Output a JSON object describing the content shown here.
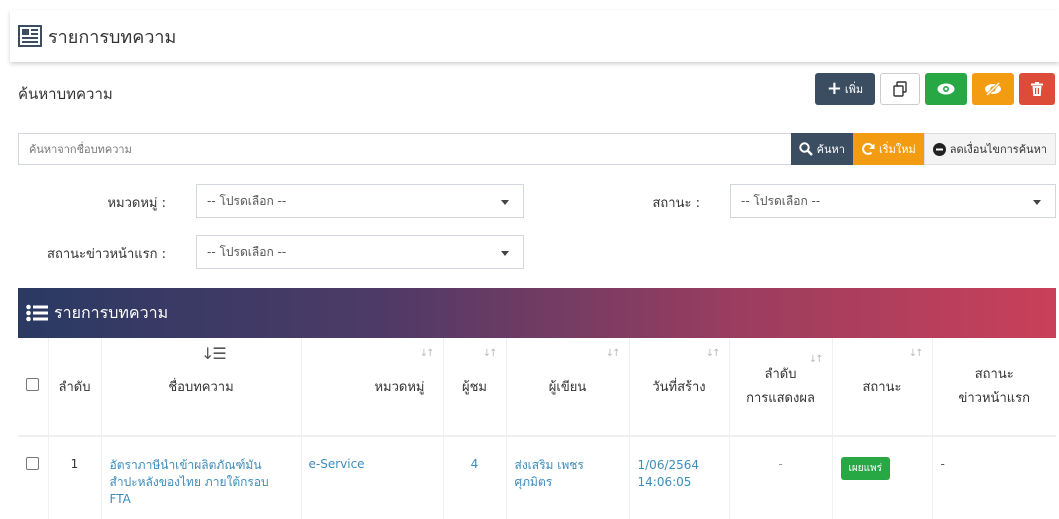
{
  "header": {
    "title": "รายการบทความ"
  },
  "search": {
    "title": "ค้นหาบทความ",
    "placeholder": "ค้นหาจากชื่อบทความ",
    "find_label": "ค้นหา",
    "reset_label": "เริ่มใหม่",
    "less_label": "ลดเงื่อนไขการค้นหา"
  },
  "toolbar": {
    "add_label": "เพิ่ม"
  },
  "filters": {
    "category_label": "หมวดหมู่ :",
    "category_value": "-- โปรดเลือก --",
    "status_label": "สถานะ :",
    "status_value": "-- โปรดเลือก --",
    "headline_label": "สถานะข่าวหน้าแรก :",
    "headline_value": "-- โปรดเลือก --"
  },
  "list": {
    "title": "รายการบทความ",
    "columns": {
      "seq": "ลำดับ",
      "name": "ชื่อบทความ",
      "category": "หมวดหมู่",
      "views": "ผู้ชม",
      "author": "ผู้เขียน",
      "created": "วันที่สร้าง",
      "order_1": "ลำดับ",
      "order_2": "การแสดงผล",
      "status": "สถานะ",
      "headline_1": "สถานะ",
      "headline_2": "ข่าวหน้าแรก"
    },
    "rows": [
      {
        "seq": "1",
        "name_1": "อัตราภาษีนำเข้าผลิตภัณฑ์มัน",
        "name_2": "สำปะหลังของไทย ภายใต้กรอบ",
        "name_3": "FTA",
        "category": "e-Service",
        "views": "4",
        "author_1": "ส่งเสริม เพชร",
        "author_2": "ศุภมิตร",
        "date": "1/06/2564",
        "time": "14:06:05",
        "order": "-",
        "status": "เผยแพร่",
        "headline": "-"
      }
    ]
  },
  "colors": {
    "primary": "#3b4d61",
    "success": "#28a745",
    "warning": "#f39c12",
    "danger": "#dd4b39",
    "link": "#3c8dbc"
  }
}
